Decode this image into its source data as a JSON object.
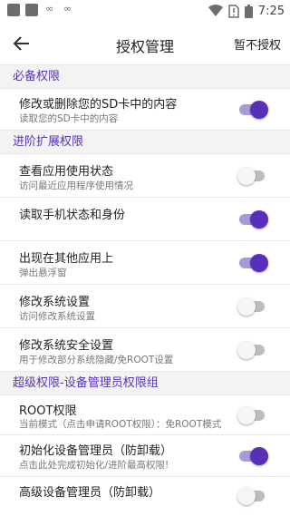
{
  "status_bar": {
    "time": "7:25",
    "left_icons": [
      "app-icon",
      "app-icon",
      "link-icon",
      "link-icon"
    ],
    "right_icons": [
      "wifi-icon",
      "no-sim-icon",
      "battery-icon"
    ]
  },
  "header": {
    "title": "授权管理",
    "action_label": "暂不授权",
    "back_icon": "arrow-left-icon"
  },
  "colors": {
    "accent": "#5a2fb8",
    "accent_track": "#a99ad6",
    "section_bg": "#f3f3f3"
  },
  "sections": [
    {
      "title": "必备权限",
      "items": [
        {
          "label": "修改或删除您的SD卡中的内容",
          "desc": "读取您的SD卡中的内容",
          "enabled": true
        }
      ]
    },
    {
      "title": "进阶扩展权限",
      "items": [
        {
          "label": "查看应用使用状态",
          "desc": "访问最近应用程序使用情况",
          "enabled": false
        },
        {
          "label": "读取手机状态和身份",
          "desc": "",
          "enabled": true
        },
        {
          "label": "出现在其他应用上",
          "desc": "弹出悬浮窗",
          "enabled": true
        },
        {
          "label": "修改系统设置",
          "desc": "访问修改系统设置",
          "enabled": false
        },
        {
          "label": "修改系统安全设置",
          "desc": "用于修改部分系统隐藏/免ROOT设置",
          "enabled": false
        }
      ]
    },
    {
      "title": "超级权限-设备管理员权限组",
      "items": [
        {
          "label": "ROOT权限",
          "desc": "当前模式（点击申请ROOT权限）：免ROOT模式",
          "enabled": false
        },
        {
          "label": "初始化设备管理员（防卸载）",
          "desc": "点击此处完成初始化/进阶最高权限!",
          "enabled": true
        },
        {
          "label": "高级设备管理员（防卸载）",
          "desc": "",
          "enabled": false
        }
      ]
    }
  ]
}
